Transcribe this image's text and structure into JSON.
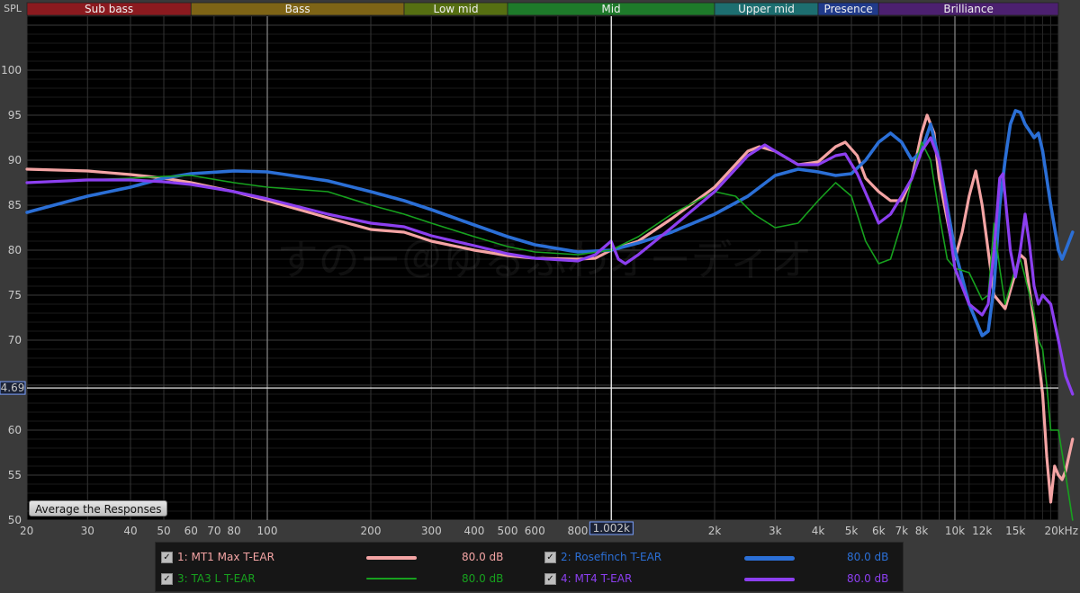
{
  "chart_data": {
    "type": "line",
    "title": "",
    "ylabel": "SPL",
    "xlabel": "",
    "x_scale": "log",
    "xlim": [
      20,
      20000
    ],
    "ylim": [
      50,
      106
    ],
    "y_ticks": [
      50,
      55,
      60,
      65,
      70,
      75,
      80,
      85,
      90,
      95,
      100
    ],
    "y_tick_labels": [
      "50",
      "55",
      "60",
      "",
      "70",
      "75",
      "80",
      "85",
      "90",
      "95",
      "100"
    ],
    "x_ticks": [
      20,
      30,
      40,
      50,
      60,
      70,
      80,
      100,
      200,
      300,
      400,
      500,
      600,
      800,
      2000,
      3000,
      4000,
      5000,
      6000,
      7000,
      8000,
      10000,
      12000,
      15000,
      20000
    ],
    "x_tick_labels": [
      "20",
      "30",
      "40",
      "50",
      "60",
      "70",
      "80",
      "100",
      "200",
      "300",
      "400",
      "500",
      "600",
      "800",
      "2k",
      "3k",
      "4k",
      "5k",
      "6k",
      "7k",
      "8k",
      "10k",
      "12k",
      "15k",
      "20kHz"
    ],
    "cursor": {
      "x_label": "1.002k",
      "x_value": 1002,
      "y_label": "4.69",
      "y_value": 64.69
    },
    "bands": [
      {
        "name": "Sub bass",
        "from": 20,
        "to": 60,
        "color": "#8b1a1f"
      },
      {
        "name": "Bass",
        "from": 60,
        "to": 250,
        "color": "#7e6416"
      },
      {
        "name": "Low mid",
        "from": 250,
        "to": 500,
        "color": "#566f12"
      },
      {
        "name": "Mid",
        "from": 500,
        "to": 2000,
        "color": "#1e7a2a"
      },
      {
        "name": "Upper mid",
        "from": 2000,
        "to": 4000,
        "color": "#1d6e70"
      },
      {
        "name": "Presence",
        "from": 4000,
        "to": 6000,
        "color": "#203a8a"
      },
      {
        "name": "Brilliance",
        "from": 6000,
        "to": 20000,
        "color": "#4c2070"
      }
    ],
    "series": [
      {
        "name": "1: MT1 Max T-EAR",
        "color": "#f4a4a4",
        "width": 3.2,
        "level": "80.0 dB",
        "points": [
          [
            20,
            89
          ],
          [
            30,
            88.8
          ],
          [
            40,
            88.4
          ],
          [
            50,
            88
          ],
          [
            60,
            87.5
          ],
          [
            80,
            86.5
          ],
          [
            100,
            85.5
          ],
          [
            150,
            83.6
          ],
          [
            200,
            82.3
          ],
          [
            250,
            82
          ],
          [
            300,
            81
          ],
          [
            400,
            80
          ],
          [
            500,
            79.4
          ],
          [
            600,
            79.1
          ],
          [
            800,
            79
          ],
          [
            900,
            79.1
          ],
          [
            1000,
            80
          ],
          [
            1200,
            81
          ],
          [
            1500,
            83.5
          ],
          [
            2000,
            87
          ],
          [
            2500,
            91
          ],
          [
            2700,
            91.5
          ],
          [
            3000,
            91
          ],
          [
            3500,
            89.5
          ],
          [
            4000,
            89.8
          ],
          [
            4500,
            91.5
          ],
          [
            4800,
            92
          ],
          [
            5200,
            90.5
          ],
          [
            5500,
            88
          ],
          [
            6000,
            86.5
          ],
          [
            6500,
            85.5
          ],
          [
            7000,
            85.5
          ],
          [
            7500,
            88
          ],
          [
            8000,
            93
          ],
          [
            8300,
            95
          ],
          [
            8700,
            93
          ],
          [
            9000,
            88
          ],
          [
            10000,
            79
          ],
          [
            10500,
            82
          ],
          [
            11000,
            86
          ],
          [
            11500,
            88.8
          ],
          [
            12000,
            85
          ],
          [
            13000,
            75
          ],
          [
            14000,
            73.5
          ],
          [
            15000,
            77.5
          ],
          [
            15500,
            79.5
          ],
          [
            16000,
            79
          ],
          [
            17000,
            72
          ],
          [
            18000,
            64
          ],
          [
            18500,
            57
          ],
          [
            19000,
            52
          ],
          [
            19500,
            56
          ],
          [
            20000,
            55
          ],
          [
            20500,
            54.5
          ],
          [
            21000,
            55.5
          ],
          [
            22000,
            59
          ]
        ]
      },
      {
        "name": "2: Rosefinch T-EAR",
        "color": "#2b6fd6",
        "width": 3.6,
        "level": "80.0 dB",
        "points": [
          [
            20,
            84.2
          ],
          [
            30,
            86
          ],
          [
            40,
            87
          ],
          [
            50,
            88
          ],
          [
            60,
            88.5
          ],
          [
            80,
            88.8
          ],
          [
            100,
            88.7
          ],
          [
            150,
            87.7
          ],
          [
            200,
            86.5
          ],
          [
            250,
            85.5
          ],
          [
            300,
            84.5
          ],
          [
            400,
            82.8
          ],
          [
            500,
            81.5
          ],
          [
            600,
            80.6
          ],
          [
            800,
            79.8
          ],
          [
            1000,
            80
          ],
          [
            1200,
            80.8
          ],
          [
            1500,
            82
          ],
          [
            2000,
            84
          ],
          [
            2500,
            86
          ],
          [
            3000,
            88.3
          ],
          [
            3500,
            89
          ],
          [
            4000,
            88.7
          ],
          [
            4500,
            88.3
          ],
          [
            5000,
            88.5
          ],
          [
            5500,
            90
          ],
          [
            6000,
            92
          ],
          [
            6500,
            93
          ],
          [
            7000,
            92
          ],
          [
            7500,
            90
          ],
          [
            8000,
            91
          ],
          [
            8500,
            94
          ],
          [
            9000,
            90
          ],
          [
            10000,
            80
          ],
          [
            11000,
            74
          ],
          [
            12000,
            70.5
          ],
          [
            12500,
            71
          ],
          [
            13000,
            76
          ],
          [
            13500,
            85
          ],
          [
            14000,
            90
          ],
          [
            14500,
            94
          ],
          [
            15000,
            95.5
          ],
          [
            15500,
            95.3
          ],
          [
            16000,
            94
          ],
          [
            17000,
            92.5
          ],
          [
            17500,
            93
          ],
          [
            18000,
            91
          ],
          [
            19000,
            85
          ],
          [
            20000,
            80
          ],
          [
            20500,
            79
          ],
          [
            21000,
            80
          ],
          [
            22000,
            82
          ]
        ]
      },
      {
        "name": "3: TA3 L T-EAR",
        "color": "#17a11e",
        "width": 1.6,
        "level": "80.0 dB",
        "points": [
          [
            20,
            87.5
          ],
          [
            30,
            87.8
          ],
          [
            40,
            88
          ],
          [
            50,
            88.2
          ],
          [
            60,
            88.3
          ],
          [
            80,
            87.5
          ],
          [
            100,
            87
          ],
          [
            150,
            86.5
          ],
          [
            200,
            85
          ],
          [
            250,
            84
          ],
          [
            300,
            83
          ],
          [
            400,
            81.5
          ],
          [
            500,
            80.4
          ],
          [
            600,
            79.8
          ],
          [
            800,
            79.5
          ],
          [
            1000,
            80
          ],
          [
            1200,
            81.5
          ],
          [
            1500,
            84
          ],
          [
            2000,
            86.5
          ],
          [
            2300,
            86
          ],
          [
            2600,
            84
          ],
          [
            3000,
            82.5
          ],
          [
            3500,
            83
          ],
          [
            4000,
            85.5
          ],
          [
            4500,
            87.5
          ],
          [
            5000,
            86
          ],
          [
            5500,
            81
          ],
          [
            6000,
            78.5
          ],
          [
            6500,
            79
          ],
          [
            7000,
            83
          ],
          [
            7500,
            88
          ],
          [
            8000,
            92
          ],
          [
            8500,
            90
          ],
          [
            9000,
            84
          ],
          [
            9500,
            79
          ],
          [
            10000,
            78
          ],
          [
            11000,
            77.5
          ],
          [
            12000,
            74.5
          ],
          [
            12500,
            75
          ],
          [
            13000,
            83
          ],
          [
            13500,
            78
          ],
          [
            14000,
            74
          ],
          [
            15000,
            78
          ],
          [
            15500,
            79
          ],
          [
            16000,
            77
          ],
          [
            17000,
            73
          ],
          [
            17500,
            70
          ],
          [
            18000,
            69
          ],
          [
            18500,
            65
          ],
          [
            19000,
            60
          ],
          [
            20000,
            60
          ],
          [
            21000,
            55
          ],
          [
            22000,
            50
          ]
        ]
      },
      {
        "name": "4: MT4 T-EAR",
        "color": "#8c3ff0",
        "width": 3.2,
        "level": "80.0 dB",
        "points": [
          [
            20,
            87.5
          ],
          [
            30,
            87.8
          ],
          [
            40,
            87.8
          ],
          [
            50,
            87.6
          ],
          [
            60,
            87.3
          ],
          [
            80,
            86.5
          ],
          [
            100,
            85.7
          ],
          [
            150,
            84
          ],
          [
            200,
            83
          ],
          [
            250,
            82.6
          ],
          [
            300,
            81.6
          ],
          [
            400,
            80.5
          ],
          [
            500,
            79.6
          ],
          [
            600,
            79.1
          ],
          [
            800,
            78.8
          ],
          [
            900,
            79.5
          ],
          [
            1000,
            81
          ],
          [
            1050,
            79
          ],
          [
            1100,
            78.5
          ],
          [
            1200,
            79.5
          ],
          [
            1500,
            82.5
          ],
          [
            2000,
            86.5
          ],
          [
            2500,
            90.5
          ],
          [
            2800,
            91.7
          ],
          [
            3000,
            91
          ],
          [
            3500,
            89.5
          ],
          [
            4000,
            89.5
          ],
          [
            4500,
            90.5
          ],
          [
            4800,
            90.7
          ],
          [
            5200,
            88.5
          ],
          [
            5700,
            85
          ],
          [
            6000,
            83
          ],
          [
            6500,
            84
          ],
          [
            7000,
            86
          ],
          [
            7500,
            88
          ],
          [
            8000,
            91
          ],
          [
            8500,
            92.5
          ],
          [
            9000,
            90
          ],
          [
            9500,
            84
          ],
          [
            10000,
            78
          ],
          [
            11000,
            74
          ],
          [
            12000,
            72.8
          ],
          [
            12500,
            74
          ],
          [
            13000,
            80
          ],
          [
            13500,
            88
          ],
          [
            13800,
            88.5
          ],
          [
            14000,
            86
          ],
          [
            14500,
            80
          ],
          [
            15000,
            77
          ],
          [
            15500,
            80
          ],
          [
            16000,
            84
          ],
          [
            16500,
            80.5
          ],
          [
            17000,
            76
          ],
          [
            17500,
            74
          ],
          [
            18000,
            75
          ],
          [
            19000,
            74
          ],
          [
            20000,
            70
          ],
          [
            21000,
            66
          ],
          [
            22000,
            64
          ]
        ]
      }
    ]
  },
  "watermark": "すのー＠ゆるふわオーディオ",
  "ui": {
    "average_button": "Average the Responses"
  },
  "legend": [
    {
      "check": "✓",
      "name": "1: MT1 Max T-EAR",
      "level": "80.0 dB",
      "color": "#f4a4a4"
    },
    {
      "check": "✓",
      "name": "2: Rosefinch T-EAR",
      "level": "80.0 dB",
      "color": "#2b6fd6"
    },
    {
      "check": "✓",
      "name": "3: TA3 L T-EAR",
      "level": "80.0 dB",
      "color": "#17a11e"
    },
    {
      "check": "✓",
      "name": "4: MT4 T-EAR",
      "level": "80.0 dB",
      "color": "#8c3ff0"
    }
  ]
}
